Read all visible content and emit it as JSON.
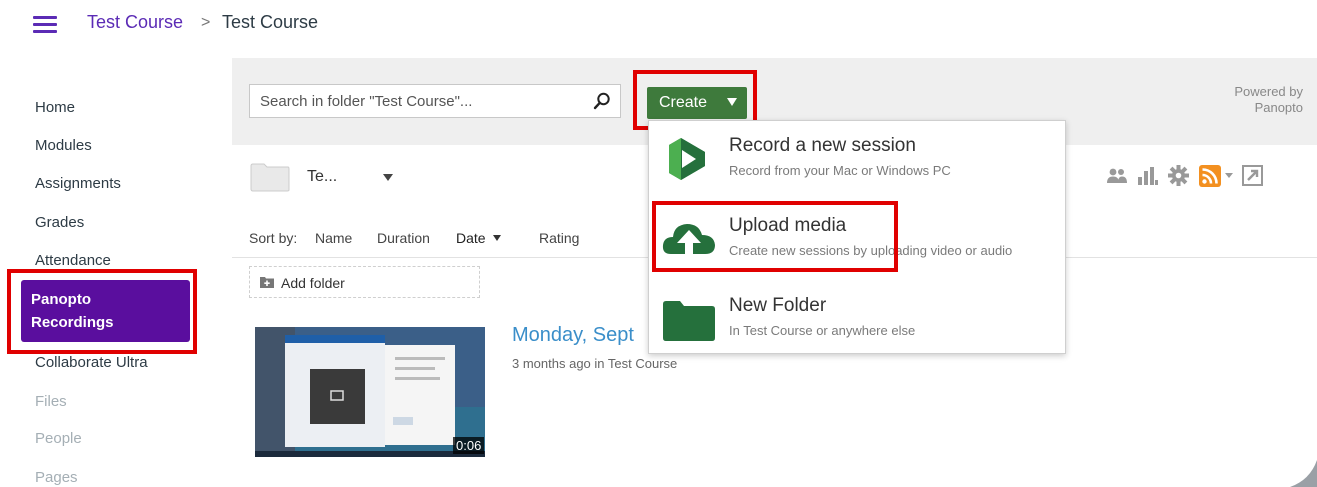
{
  "breadcrumb": {
    "course_link": "Test Course",
    "separator": ">",
    "current": "Test Course"
  },
  "nav": {
    "items": [
      {
        "label": "Home",
        "enabled": true
      },
      {
        "label": "Modules",
        "enabled": true
      },
      {
        "label": "Assignments",
        "enabled": true
      },
      {
        "label": "Grades",
        "enabled": true
      },
      {
        "label": "Attendance",
        "enabled": true
      },
      {
        "label": "Panopto Recordings",
        "enabled": true,
        "active": true
      },
      {
        "label": "Collaborate Ultra",
        "enabled": true
      },
      {
        "label": "Files",
        "enabled": false
      },
      {
        "label": "People",
        "enabled": false
      },
      {
        "label": "Pages",
        "enabled": false
      }
    ]
  },
  "panopto": {
    "search_placeholder": "Search in folder \"Test Course\"...",
    "create_label": "Create",
    "powered_by_line1": "Powered by",
    "powered_by_line2": "Panopto",
    "folder_name": "Te...",
    "sort_label": "Sort by:",
    "sort_options": [
      "Name",
      "Duration",
      "Date",
      "Rating"
    ],
    "sort_active": "Date",
    "add_folder_label": "Add folder",
    "session": {
      "title": "Monday, Sept",
      "meta_prefix": "3 months ago in",
      "meta_folder": "Test Course",
      "duration": "0:06"
    },
    "dropdown": [
      {
        "title": "Record a new session",
        "desc": "Record from your Mac or Windows PC",
        "icon": "panopto-play-icon"
      },
      {
        "title": "Upload media",
        "desc": "Create new sessions by uploading video or audio",
        "icon": "cloud-upload-icon"
      },
      {
        "title": "New Folder",
        "desc": "In Test Course or anywhere else",
        "icon": "folder-icon"
      }
    ]
  },
  "colors": {
    "canvas_purple": "#5a0e9e",
    "link_purple": "#5b2bb5",
    "create_green": "#3e7a3c",
    "highlight_red": "#e00000",
    "session_blue": "#3a8ec9",
    "rss_orange": "#f39020"
  }
}
